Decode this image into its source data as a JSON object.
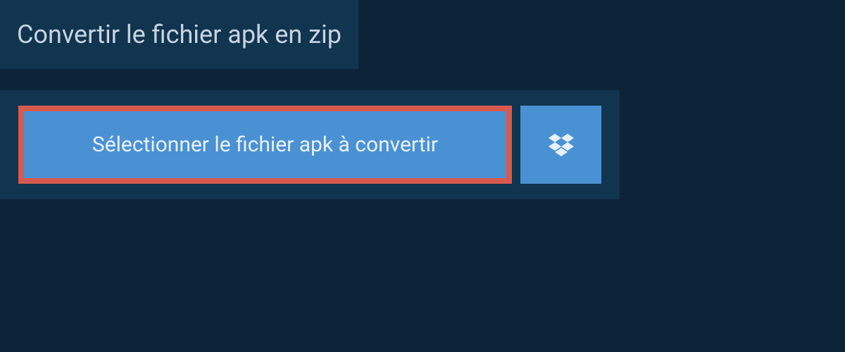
{
  "header": {
    "title": "Convertir le fichier apk en zip"
  },
  "buttons": {
    "select_file_label": "Sélectionner le fichier apk à convertir"
  },
  "colors": {
    "background": "#0d2438",
    "panel": "#11344f",
    "button_primary": "#4a91d3",
    "highlight_border": "#d85a4f",
    "text_light": "#c8d4df"
  }
}
